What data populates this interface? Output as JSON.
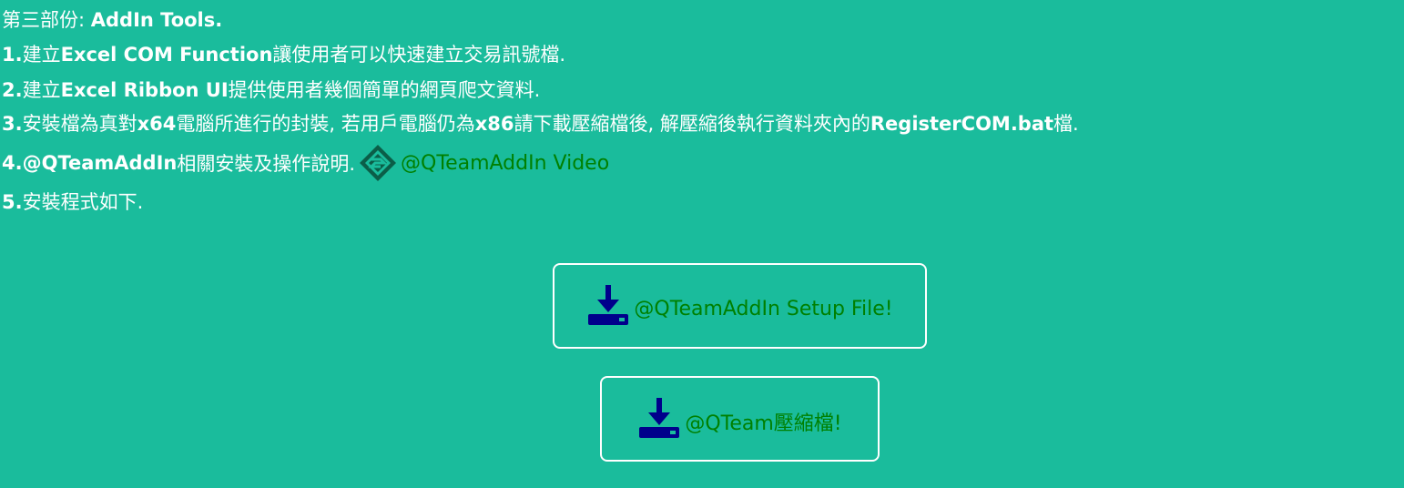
{
  "intro": {
    "part_prefix": "第三部份:",
    "part_title": "AddIn Tools."
  },
  "items": [
    {
      "index": "1.",
      "segments": [
        {
          "text": "建立",
          "bold": false
        },
        {
          "text": "Excel COM Function",
          "bold": true
        },
        {
          "text": "讓使用者可以快速建立交易訊號檔.",
          "bold": false
        }
      ]
    },
    {
      "index": "2.",
      "segments": [
        {
          "text": "建立",
          "bold": false
        },
        {
          "text": "Excel Ribbon UI",
          "bold": true
        },
        {
          "text": "提供使用者幾個簡單的網頁爬文資料.",
          "bold": false
        }
      ]
    },
    {
      "index": "3.",
      "segments": [
        {
          "text": "安裝檔為真對",
          "bold": false
        },
        {
          "text": "x64",
          "bold": true
        },
        {
          "text": "電腦所進行的封裝, 若用戶電腦仍為",
          "bold": false
        },
        {
          "text": "x86",
          "bold": true
        },
        {
          "text": "請下載壓縮檔後, 解壓縮後執行資料夾內的",
          "bold": false
        },
        {
          "text": "RegisterCOM.bat",
          "bold": true
        },
        {
          "text": "檔.",
          "bold": false
        }
      ]
    }
  ],
  "item4": {
    "index": "4.",
    "name": "@QTeamAddIn",
    "text": "相關安裝及操作說明.",
    "video_link": "@QTeamAddIn Video",
    "logo_icon": "qteam-diamond-logo-icon"
  },
  "item5": {
    "index": "5.",
    "text": "安裝程式如下."
  },
  "downloads": {
    "setup_label": "@QTeamAddIn Setup File!",
    "zip_label": "@QTeam壓縮檔!",
    "icon": "download-icon"
  },
  "colors": {
    "background": "#1abc9c",
    "link": "#008000",
    "icon": "#00008b",
    "logo": "#0b5e48",
    "text": "#ffffff"
  }
}
